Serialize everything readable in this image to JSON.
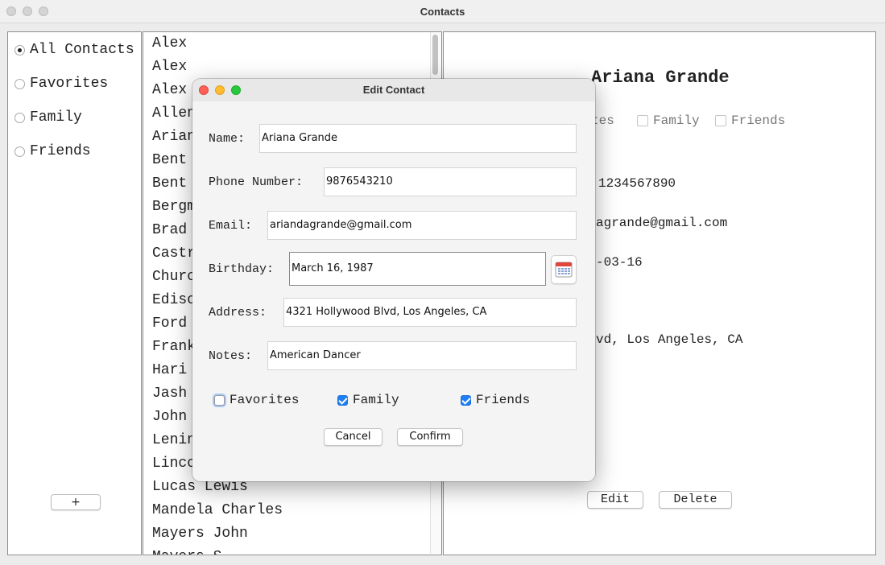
{
  "window": {
    "title": "Contacts"
  },
  "sidebar": {
    "filters": [
      {
        "label": "All Contacts",
        "selected": true
      },
      {
        "label": "Favorites",
        "selected": false
      },
      {
        "label": "Family",
        "selected": false
      },
      {
        "label": "Friends",
        "selected": false
      }
    ],
    "add_label": "+"
  },
  "contact_list": {
    "items": [
      "Alex",
      "Alex",
      "Alex",
      "Allen",
      "Arian",
      "Bent",
      "Bent",
      "Bergm",
      "Brad",
      "Castr",
      "Churc",
      "Ediso",
      "Ford",
      "Frank",
      "Hari",
      "Jash",
      "John",
      "Lenin",
      "Linco",
      "Lucas Lewis",
      "Mandela Charles",
      "Mayers John",
      "Mayers S"
    ]
  },
  "detail": {
    "name": "Ariana Grande",
    "favorites_partial": "tes",
    "family_label": "Family",
    "friends_label": "Friends",
    "phone_partial": "1234567890",
    "email_partial": "agrande@gmail.com",
    "birthday_partial": "-03-16",
    "address_partial": "vd, Los Angeles, CA",
    "edit_label": "Edit",
    "delete_label": "Delete"
  },
  "dialog": {
    "title": "Edit Contact",
    "fields": {
      "name_label": "Name:",
      "name_value": "Ariana Grande",
      "phone_label": "Phone Number:",
      "phone_value": "9876543210",
      "email_label": "Email:",
      "email_value": "ariandagrande@gmail.com",
      "birthday_label": "Birthday:",
      "birthday_value": "March 16, 1987",
      "address_label": "Address:",
      "address_value": "4321 Hollywood Blvd, Los Angeles, CA",
      "notes_label": "Notes:",
      "notes_value": "American Dancer"
    },
    "checkboxes": [
      {
        "label": "Favorites",
        "checked": false
      },
      {
        "label": "Family",
        "checked": true
      },
      {
        "label": "Friends",
        "checked": true
      }
    ],
    "cancel_label": "Cancel",
    "confirm_label": "Confirm"
  },
  "colors": {
    "accent": "#1e7ef5",
    "close": "#ff5f57",
    "minimize": "#febc2e",
    "zoom": "#28c840"
  }
}
